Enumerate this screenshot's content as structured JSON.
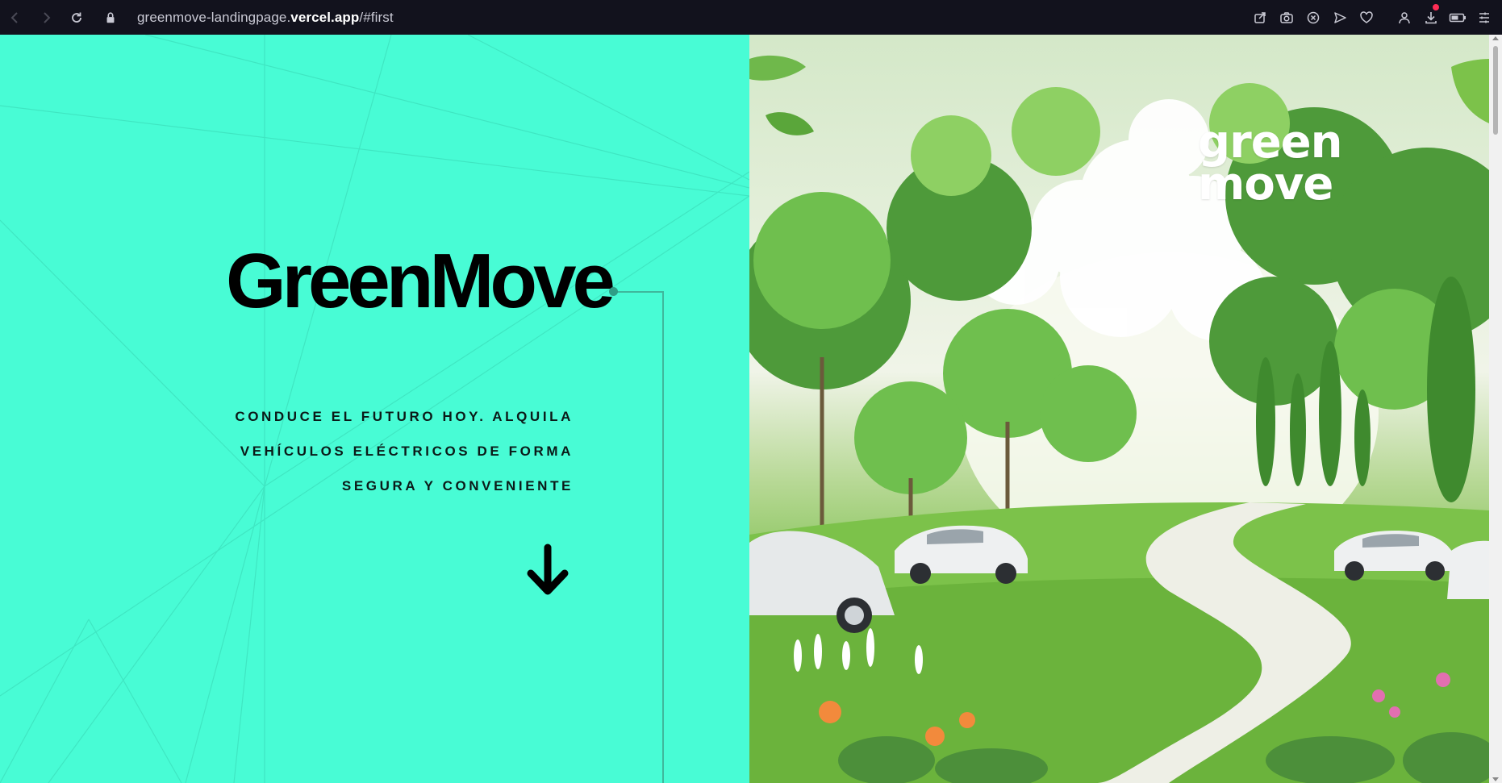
{
  "browser": {
    "url_prefix": "greenmove-landingpage.",
    "url_domain": "vercel.app",
    "url_suffix": "/#first",
    "toolbar_icons": [
      "share-icon",
      "camera-icon",
      "close-circle-icon",
      "send-icon",
      "heart-icon",
      "profile-icon",
      "download-icon",
      "battery-icon",
      "menu-icon"
    ]
  },
  "hero": {
    "brand": "GreenMove",
    "tagline_lines": [
      "CONDUCE EL FUTURO HOY. ALQUILA",
      "VEHÍCULOS ELÉCTRICOS DE FORMA",
      "SEGURA Y CONVENIENTE"
    ]
  },
  "image": {
    "logo_line1": "green",
    "logo_line2": "move"
  },
  "colors": {
    "hero_bg": "#48fcd5",
    "accent_line": "#3fb79c",
    "chrome_bg": "#12121d"
  }
}
